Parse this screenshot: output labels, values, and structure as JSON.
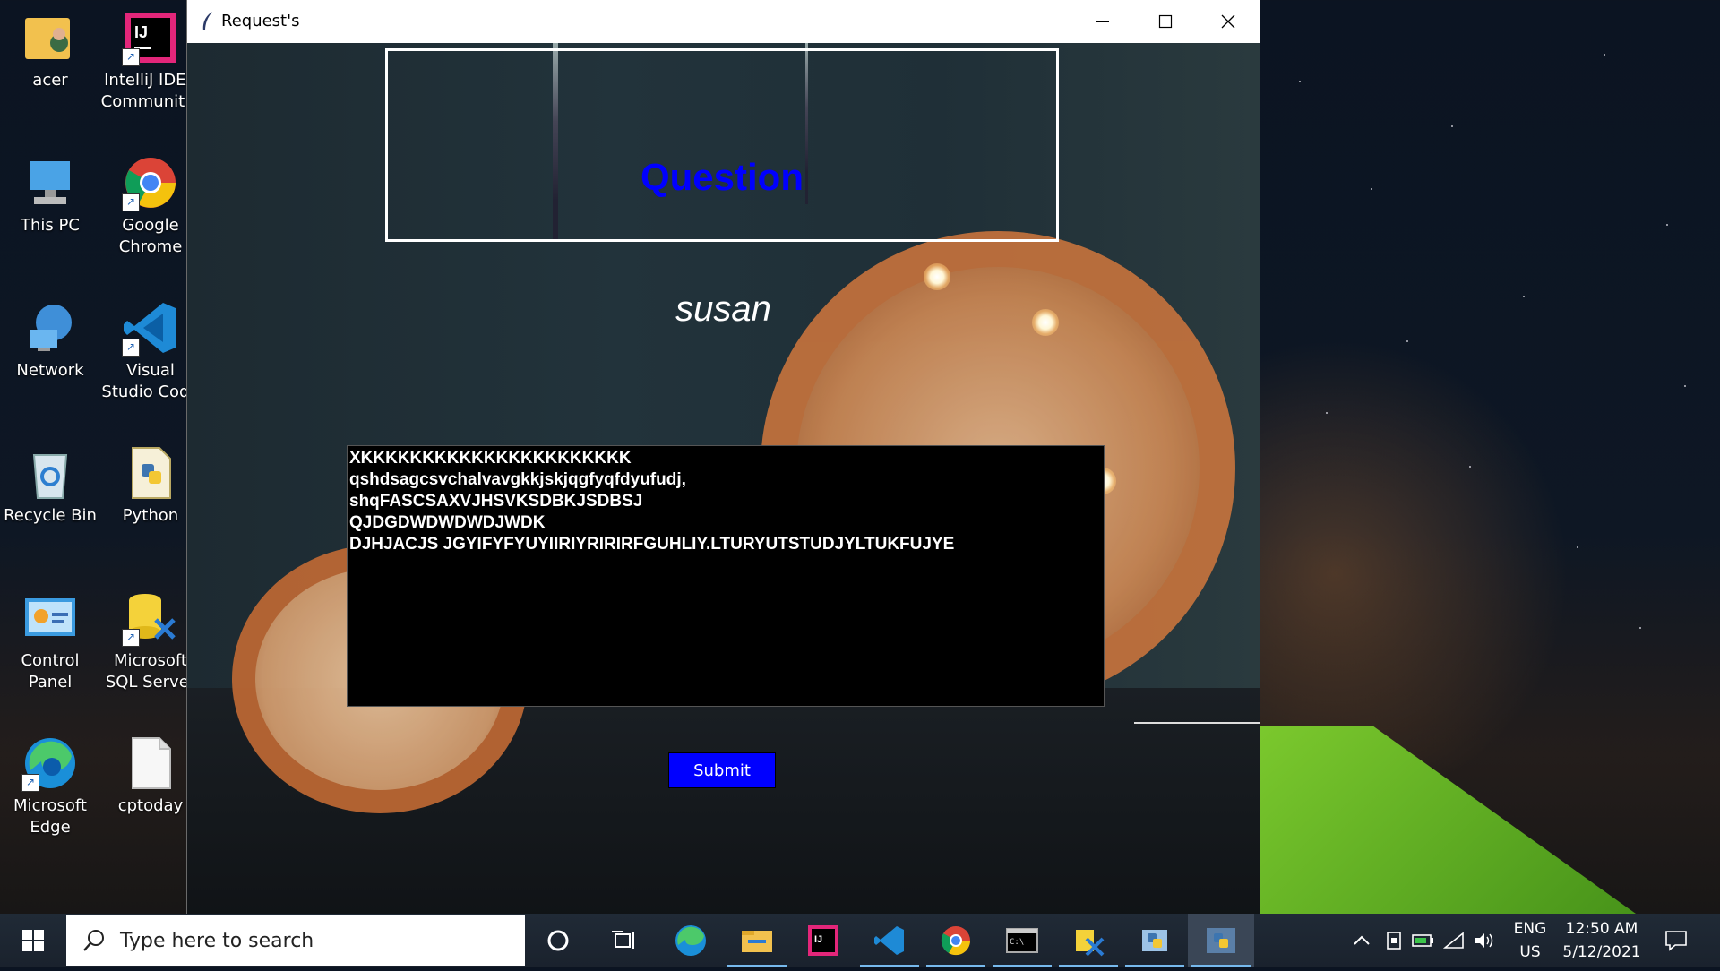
{
  "desktop": {
    "icons": [
      {
        "label": "acer",
        "icon": "user-folder-icon"
      },
      {
        "label": "IntelliJ IDEA Communit...",
        "icon": "intellij-idea-icon"
      },
      {
        "label": "This PC",
        "icon": "computer-icon"
      },
      {
        "label": "Google Chrome",
        "icon": "chrome-icon"
      },
      {
        "label": "Network",
        "icon": "network-icon"
      },
      {
        "label": "Visual Studio Code",
        "icon": "vscode-icon"
      },
      {
        "label": "Recycle Bin",
        "icon": "recycle-bin-icon"
      },
      {
        "label": "Python",
        "icon": "python-file-icon"
      },
      {
        "label": "Control Panel",
        "icon": "control-panel-icon"
      },
      {
        "label": "Microsoft SQL Server",
        "icon": "sql-server-icon"
      },
      {
        "label": "Microsoft Edge",
        "icon": "edge-icon"
      },
      {
        "label": "cptoday",
        "icon": "text-file-icon"
      }
    ]
  },
  "window": {
    "title": "Request's",
    "question_label": "Question",
    "user_label": "susan",
    "answer_text": "XKKKKKKKKKKKKKKKKKKKKKK\nqshdsagcsvchalvavgkkjskjqgfyqfdyufudj,\nshqFASCSAXVJHSVKSDBKJSDBSJ\nQJDGDWDWDWDJWDK\nDJHJACJS JGYIFYFYUYIIRIYRIRIRFGUHLIY.LTURYUTSTUDJYLTUKFUJYE",
    "submit_label": "Submit"
  },
  "taskbar": {
    "search_placeholder": "Type here to search",
    "apps": [
      "cortana-icon",
      "task-view-icon",
      "edge-icon",
      "file-explorer-icon",
      "intellij-idea-icon",
      "vscode-icon",
      "chrome-icon",
      "terminal-icon",
      "sql-tool-icon",
      "python-app-icon",
      "python-window-icon"
    ],
    "tray": {
      "language_line1": "ENG",
      "language_line2": "US",
      "time": "12:50 AM",
      "date": "5/12/2021"
    }
  },
  "colors": {
    "question_text": "#0000ff",
    "submit_bg": "#0000ff",
    "answer_bg": "#000000",
    "taskbar_bg": "#1f2937"
  }
}
